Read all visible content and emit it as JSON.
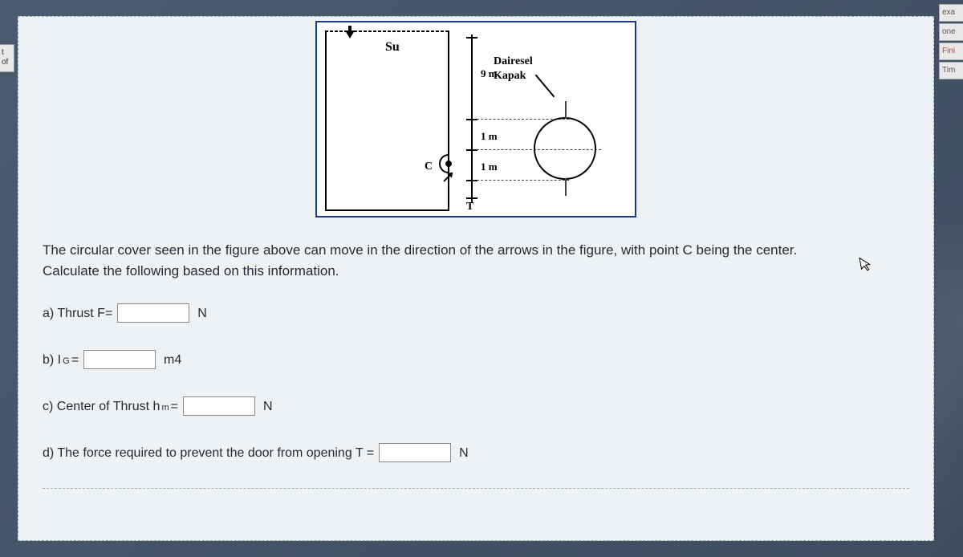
{
  "left_tab": "t of",
  "right_tabs": [
    "exa",
    "one",
    "Fini",
    "Tim"
  ],
  "figure": {
    "su_label": "Su",
    "c_label": "C",
    "t_label": "T",
    "cover_label_line1": "Dairesel",
    "cover_label_line2": "Kapak",
    "dim_9m": "9 m",
    "dim_1m_upper": "1 m",
    "dim_1m_lower": "1 m"
  },
  "question_line1": "The circular cover seen in the figure above can move in the direction of the arrows in the figure, with point C being the center.",
  "question_line2": "Calculate the following based on this information.",
  "parts": {
    "a_label": "a) Thrust F=",
    "a_unit": "N",
    "b_label_prefix": "b) I ",
    "b_label_sub": "G",
    "b_label_suffix": " =",
    "b_unit": "m4",
    "c_label_prefix": "c) Center of Thrust  h ",
    "c_label_sub": "m",
    "c_label_suffix": " =",
    "c_unit": "N",
    "d_label": "d) The force required to prevent the door from opening  T =",
    "d_unit": "N"
  }
}
